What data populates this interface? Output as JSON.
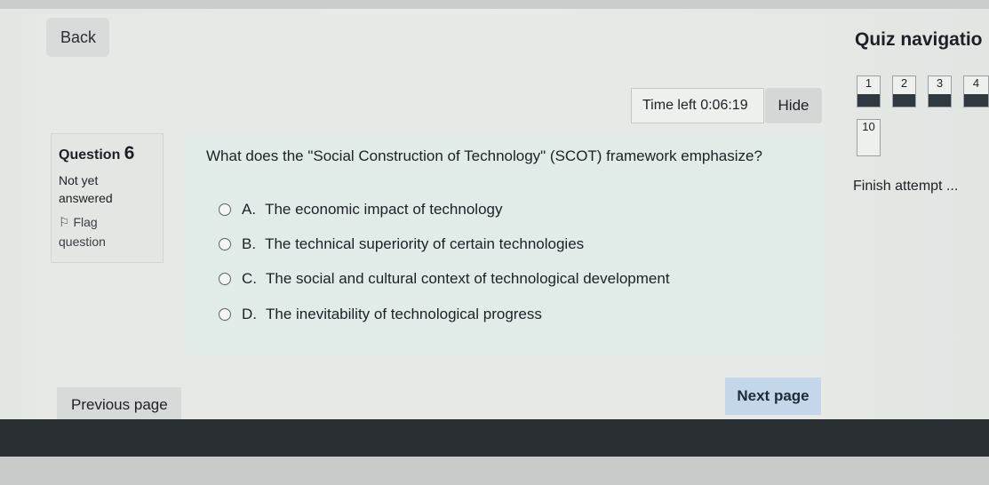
{
  "back_label": "Back",
  "timer": {
    "label": "Time left",
    "value": "0:06:19",
    "hide_label": "Hide"
  },
  "question_info": {
    "title": "Question",
    "number": "6",
    "status_line1": "Not yet",
    "status_line2": "answered",
    "flag_line1": "Flag",
    "flag_line2": "question"
  },
  "question": {
    "text": "What does the \"Social Construction of Technology\" (SCOT) framework emphasize?",
    "options": [
      {
        "letter": "A.",
        "text": "The economic impact of technology"
      },
      {
        "letter": "B.",
        "text": "The technical superiority of certain technologies"
      },
      {
        "letter": "C.",
        "text": "The social and cultural context of technological development"
      },
      {
        "letter": "D.",
        "text": "The inevitability of technological progress"
      }
    ]
  },
  "buttons": {
    "previous": "Previous page",
    "next": "Next page"
  },
  "quiz_nav": {
    "title": "Quiz navigatio",
    "items": [
      "1",
      "2",
      "3",
      "4",
      "10"
    ],
    "finish": "Finish attempt ..."
  }
}
